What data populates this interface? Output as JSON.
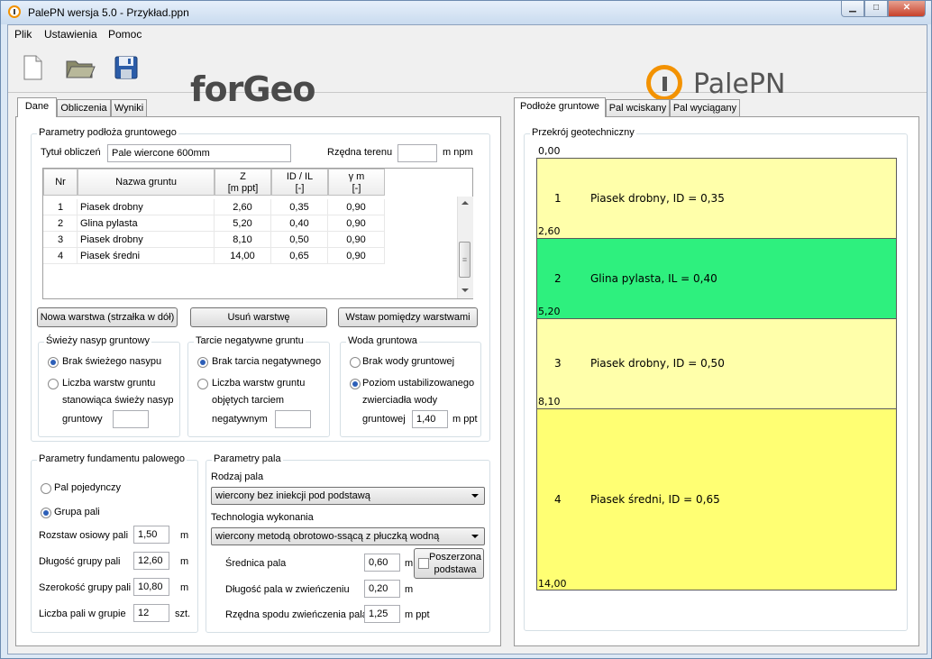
{
  "window": {
    "title": "PalePN wersja 5.0 - Przykład.ppn"
  },
  "menu": [
    "Plik",
    "Ustawienia",
    "Pomoc"
  ],
  "logos": {
    "left": "forGeo",
    "right": "PalePN"
  },
  "left_tabs": [
    "Dane",
    "Obliczenia",
    "Wyniki"
  ],
  "right_tabs": [
    "Podłoże gruntowe",
    "Pal wciskany",
    "Pal wyciągany"
  ],
  "soil_params": {
    "title": "Parametry podłoża gruntowego",
    "calc_title_label": "Tytuł obliczeń",
    "calc_title_value": "Pale wiercone 600mm",
    "terrain_label": "Rzędna terenu",
    "terrain_value": "",
    "terrain_unit": "m npm",
    "headers": {
      "nr": "Nr",
      "name": "Nazwa gruntu",
      "z": "Z",
      "z_unit": "[m ppt]",
      "idil": "ID / IL",
      "idil_unit": "[-]",
      "gamma": "γ m",
      "gamma_unit": "[-]"
    },
    "rows": [
      {
        "nr": "1",
        "name": "Piasek drobny",
        "z": "2,60",
        "idil": "0,35",
        "gamma": "0,90"
      },
      {
        "nr": "2",
        "name": "Glina pylasta",
        "z": "5,20",
        "idil": "0,40",
        "gamma": "0,90"
      },
      {
        "nr": "3",
        "name": "Piasek drobny",
        "z": "8,10",
        "idil": "0,50",
        "gamma": "0,90"
      },
      {
        "nr": "4",
        "name": "Piasek średni",
        "z": "14,00",
        "idil": "0,65",
        "gamma": "0,90"
      }
    ],
    "btn_new": "Nowa warstwa (strzałka w dół)",
    "btn_delete": "Usuń warstwę",
    "btn_insert": "Wstaw pomiędzy warstwami"
  },
  "fresh_fill": {
    "title": "Świeży nasyp gruntowy",
    "opt1": "Brak świeżego nasypu",
    "opt2_l1": "Liczba warstw gruntu",
    "opt2_l2": "stanowiąca świeży nasyp",
    "opt2_l3": "gruntowy",
    "value": ""
  },
  "neg_friction": {
    "title": "Tarcie negatywne gruntu",
    "opt1": "Brak tarcia negatywnego",
    "opt2_l1": "Liczba warstw gruntu",
    "opt2_l2": "objętych tarciem",
    "opt2_l3": "negatywnym",
    "value": ""
  },
  "groundwater": {
    "title": "Woda gruntowa",
    "opt1": "Brak wody gruntowej",
    "opt2_l1": "Poziom ustabilizowanego",
    "opt2_l2": "zwierciadła wody",
    "opt2_l3": "gruntowej",
    "value": "1,40",
    "unit": "m ppt"
  },
  "foundation": {
    "title": "Parametry fundamentu palowego",
    "opt_single": "Pal pojedynczy",
    "opt_group": "Grupa pali",
    "spacing_label": "Rozstaw osiowy pali",
    "spacing_value": "1,50",
    "length_label": "Długość grupy pali",
    "length_value": "12,60",
    "width_label": "Szerokość grupy pali",
    "width_value": "10,80",
    "count_label": "Liczba pali w grupie",
    "count_value": "12",
    "unit_m": "m",
    "unit_pcs": "szt."
  },
  "pile": {
    "title": "Parametry pala",
    "type_label": "Rodzaj pala",
    "type_value": "wiercony bez iniekcji pod podstawą",
    "tech_label": "Technologia wykonania",
    "tech_value": "wiercony metodą obrotowo-ssącą z płuczką wodną",
    "diameter_label": "Średnica pala",
    "diameter_value": "0,60",
    "widened_l1": "Poszerzona",
    "widened_l2": "podstawa",
    "cap_len_label": "Długość pala w zwieńczeniu",
    "cap_len_value": "0,20",
    "cap_level_label": "Rzędna spodu zwieńczenia pala",
    "cap_level_value": "1,25",
    "unit_m": "m",
    "unit_mppt": "m ppt"
  },
  "profile": {
    "title": "Przekrój geotechniczny",
    "top_label": "0,00",
    "layers": [
      {
        "num": "1",
        "desc": "Piasek drobny, ID = 0,35",
        "bottom": "2,60",
        "bottom_val": 2.6,
        "color": "#ffffaa"
      },
      {
        "num": "2",
        "desc": "Glina pylasta, IL = 0,40",
        "bottom": "5,20",
        "bottom_val": 5.2,
        "color": "#2ef07e"
      },
      {
        "num": "3",
        "desc": "Piasek drobny, ID = 0,50",
        "bottom": "8,10",
        "bottom_val": 8.1,
        "color": "#ffffaa"
      },
      {
        "num": "4",
        "desc": "Piasek średni, ID = 0,65",
        "bottom": "14,00",
        "bottom_val": 14.0,
        "color": "#ffff73"
      }
    ]
  }
}
